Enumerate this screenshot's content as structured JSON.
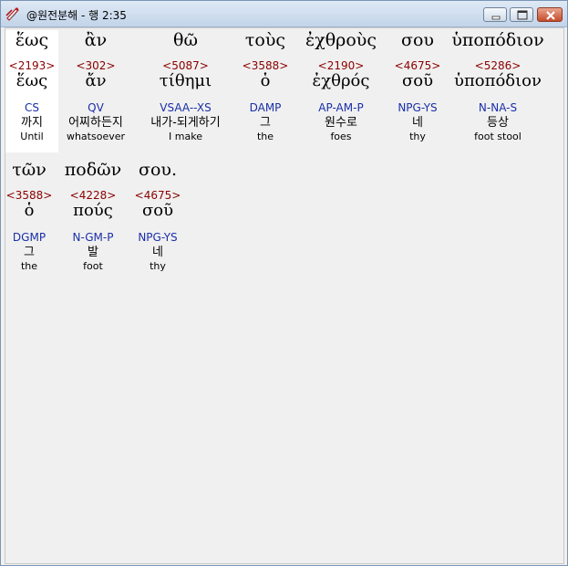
{
  "window": {
    "title": "@원전분해 - 행 2:35"
  },
  "row1": [
    {
      "greek": "ἕως",
      "strong": "<2193>",
      "lemma": "ἕως",
      "parse": "CS",
      "korean": "까지",
      "english": "Until"
    },
    {
      "greek": "ἂν",
      "strong": "<302>",
      "lemma": "ἄν",
      "parse": "QV",
      "korean": "어찌하든지",
      "english": "whatsoever"
    },
    {
      "greek": "θῶ",
      "strong": "<5087>",
      "lemma": "τίθημι",
      "parse": "VSAA--XS",
      "korean": "내가-되게하기",
      "english": "I make"
    },
    {
      "greek": "τοὺς",
      "strong": "<3588>",
      "lemma": "ὁ",
      "parse": "DAMP",
      "korean": "그",
      "english": "the"
    },
    {
      "greek": "ἐχθροὺς",
      "strong": "<2190>",
      "lemma": "ἐχθρός",
      "parse": "AP-AM-P",
      "korean": "원수로",
      "english": "foes"
    },
    {
      "greek": "σου",
      "strong": "<4675>",
      "lemma": "σοῦ",
      "parse": "NPG-YS",
      "korean": "네",
      "english": "thy"
    },
    {
      "greek": "ὑποπόδιον",
      "strong": "<5286>",
      "lemma": "ὑποπόδιον",
      "parse": "N-NA-S",
      "korean": "등상",
      "english": "foot stool"
    }
  ],
  "row2": [
    {
      "greek": "τῶν",
      "strong": "<3588>",
      "lemma": "ὁ",
      "parse": "DGMP",
      "korean": "그",
      "english": "the"
    },
    {
      "greek": "ποδῶν",
      "strong": "<4228>",
      "lemma": "πούς",
      "parse": "N-GM-P",
      "korean": "발",
      "english": "foot"
    },
    {
      "greek": "σου.",
      "strong": "<4675>",
      "lemma": "σοῦ",
      "parse": "NPG-YS",
      "korean": "네",
      "english": "thy"
    }
  ]
}
